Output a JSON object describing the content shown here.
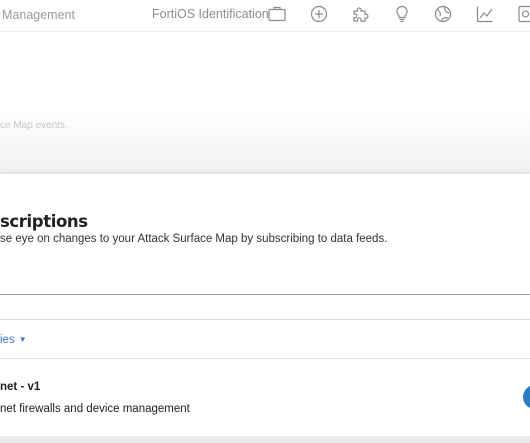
{
  "header": {
    "breadcrumb": "Management",
    "fortios_label": "FortiOS Identification",
    "icons": [
      "briefcase-icon",
      "plus-circle-icon",
      "puzzle-icon",
      "lightbulb-icon",
      "globe-icon",
      "line-chart-icon",
      "document-icon"
    ]
  },
  "upper": {
    "hint": "ce Map events."
  },
  "subscriptions": {
    "title": "scriptions",
    "description": "se eye on changes to your Attack Surface Map by subscribing to data feeds.",
    "filter_label": "ies",
    "items": [
      {
        "name": "net - v1",
        "description": "net firewalls and device management"
      }
    ]
  },
  "colors": {
    "accent": "#3a7fc4",
    "toggle": "#2a7bc0"
  }
}
